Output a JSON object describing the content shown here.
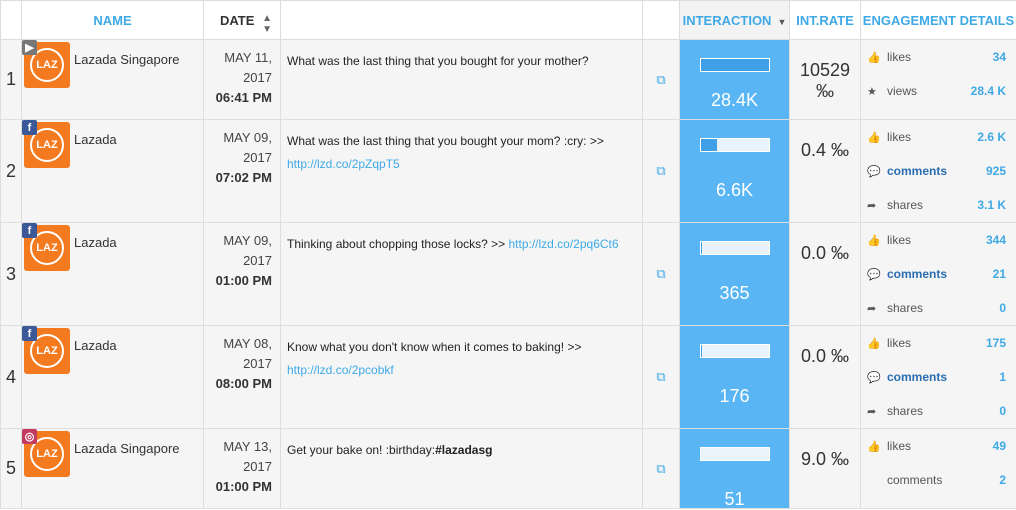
{
  "headers": {
    "name": "NAME",
    "date": "DATE",
    "interaction": "INTERACTION",
    "int_rate": "INT.RATE",
    "engagement": "ENGAGEMENT DETAILS"
  },
  "rows": [
    {
      "num": "1",
      "network": "video",
      "name": "Lazada Singapore",
      "date": "MAY 11,",
      "year": "2017",
      "time": "06:41 PM",
      "msg": "What was the last thing that you bought for your mother?",
      "link": "",
      "hashtag": "",
      "interaction": "28.4K",
      "fill": 1.0,
      "rate": "10529 ‰",
      "eng": [
        {
          "icon": "thumb",
          "label": "likes",
          "value": "34"
        },
        {
          "icon": "star",
          "label": "views",
          "value": "28.4 K"
        }
      ]
    },
    {
      "num": "2",
      "network": "facebook",
      "name": "Lazada",
      "date": "MAY 09,",
      "year": "2017",
      "time": "07:02 PM",
      "msg": "What was the last thing that you bought your mom? :cry: >> ",
      "link": "http://lzd.co/2pZqpT5",
      "hashtag": "",
      "interaction": "6.6K",
      "fill": 0.23,
      "rate": "0.4 ‰",
      "eng": [
        {
          "icon": "thumb",
          "label": "likes",
          "value": "2.6 K"
        },
        {
          "icon": "comment",
          "label": "comments",
          "value": "925",
          "strong": true
        },
        {
          "icon": "share",
          "label": "shares",
          "value": "3.1 K"
        }
      ]
    },
    {
      "num": "3",
      "network": "facebook",
      "name": "Lazada",
      "date": "MAY 09,",
      "year": "2017",
      "time": "01:00 PM",
      "msg": "Thinking about chopping those locks? >> ",
      "link": "http://lzd.co/2pq6Ct6",
      "hashtag": "",
      "interaction": "365",
      "fill": 0.02,
      "rate": "0.0 ‰",
      "eng": [
        {
          "icon": "thumb",
          "label": "likes",
          "value": "344"
        },
        {
          "icon": "comment",
          "label": "comments",
          "value": "21",
          "strong": true
        },
        {
          "icon": "share",
          "label": "shares",
          "value": "0"
        }
      ]
    },
    {
      "num": "4",
      "network": "facebook",
      "name": "Lazada",
      "date": "MAY 08,",
      "year": "2017",
      "time": "08:00 PM",
      "msg": "Know what you don't know when it comes to baking! >> ",
      "link": "http://lzd.co/2pcobkf",
      "hashtag": "",
      "interaction": "176",
      "fill": 0.01,
      "rate": "0.0 ‰",
      "eng": [
        {
          "icon": "thumb",
          "label": "likes",
          "value": "175"
        },
        {
          "icon": "comment",
          "label": "comments",
          "value": "1",
          "strong": true
        },
        {
          "icon": "share",
          "label": "shares",
          "value": "0"
        }
      ]
    },
    {
      "num": "5",
      "network": "instagram",
      "name": "Lazada Singapore",
      "date": "MAY 13,",
      "year": "2017",
      "time": "01:00 PM",
      "msg": "Get your bake on! :birthday:",
      "link": "",
      "hashtag": "#lazadasg",
      "interaction": "51",
      "fill": 0.0,
      "rate": "9.0 ‰",
      "eng": [
        {
          "icon": "thumb",
          "label": "likes",
          "value": "49"
        },
        {
          "icon": "none",
          "label": "comments",
          "value": "2"
        }
      ]
    }
  ]
}
